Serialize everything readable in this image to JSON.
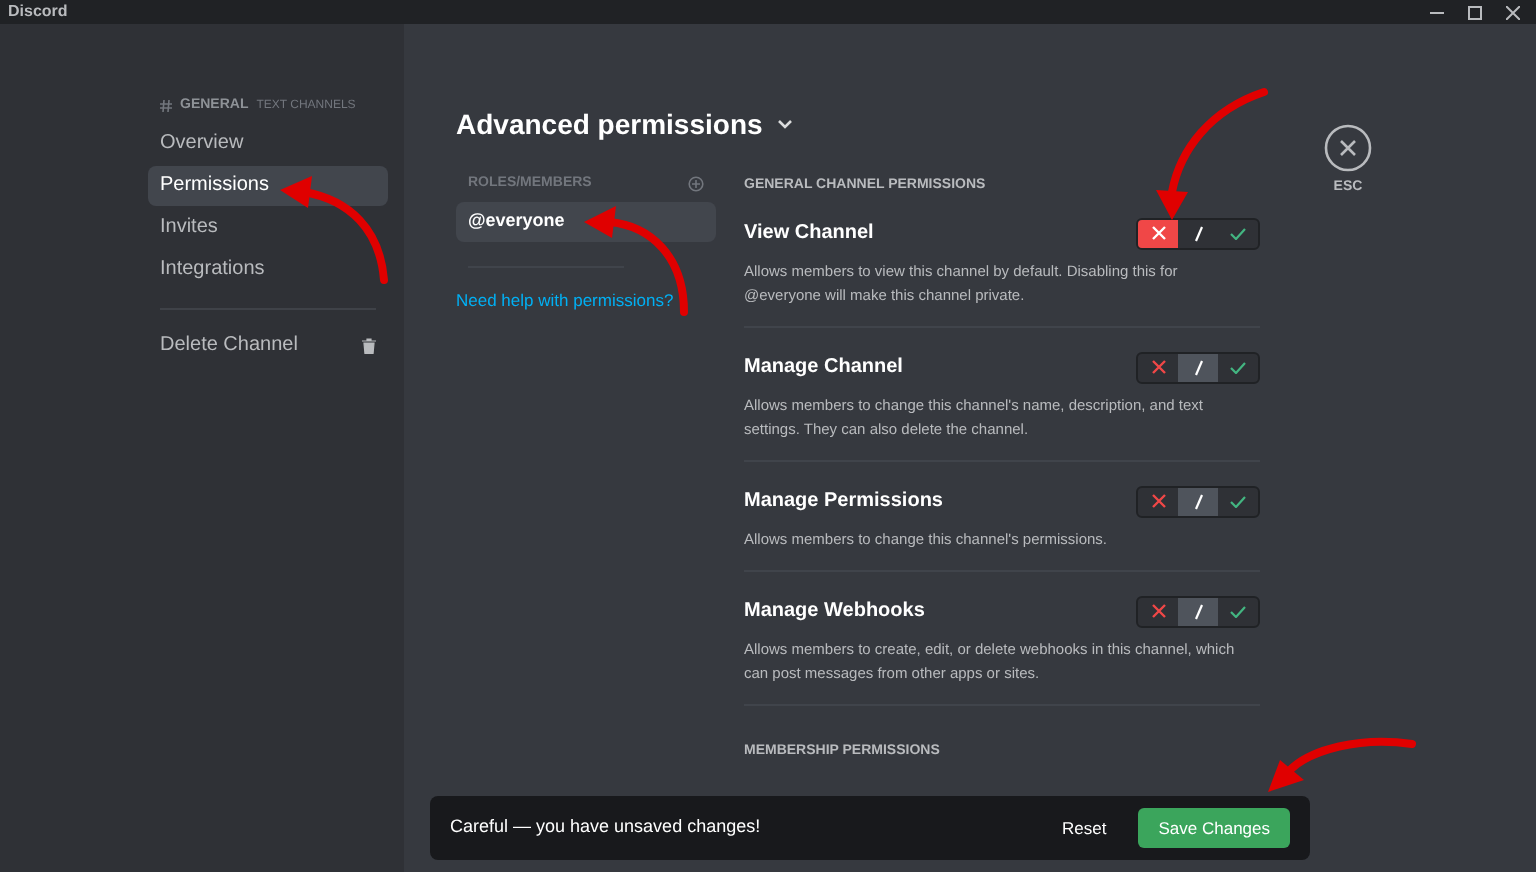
{
  "window": {
    "title": "Discord"
  },
  "sidebar": {
    "header": "GENERAL",
    "header_suffix": "TEXT CHANNELS",
    "items": [
      {
        "label": "Overview",
        "selected": false
      },
      {
        "label": "Permissions",
        "selected": true
      },
      {
        "label": "Invites",
        "selected": false
      },
      {
        "label": "Integrations",
        "selected": false
      }
    ],
    "delete": "Delete Channel"
  },
  "page_title": "Advanced permissions",
  "roles": {
    "header": "ROLES/MEMBERS",
    "items": [
      {
        "label": "@everyone",
        "selected": true
      }
    ],
    "help_link": "Need help with permissions?"
  },
  "section": "GENERAL CHANNEL PERMISSIONS",
  "permissions": [
    {
      "name": "View Channel",
      "description": "Allows members to view this channel by default. Disabling this for @everyone will make this channel private.",
      "denied": true,
      "allowed": false
    },
    {
      "name": "Manage Channel",
      "description": "Allows members to change this channel's name, description, and text settings. They can also delete the channel.",
      "denied": false,
      "allowed": false
    },
    {
      "name": "Manage Permissions",
      "description": "Allows members to change this channel's permissions.",
      "denied": false,
      "allowed": false
    },
    {
      "name": "Manage Webhooks",
      "description": "Allows members to create, edit, or delete webhooks in this channel, which can post messages from other apps or sites.",
      "denied": false,
      "allowed": false
    }
  ],
  "section_2": "MEMBERSHIP PERMISSIONS",
  "close": {
    "label": "ESC"
  },
  "toast": {
    "message": "Careful — you have unsaved changes!",
    "reset": "Reset",
    "save": "Save Changes"
  }
}
